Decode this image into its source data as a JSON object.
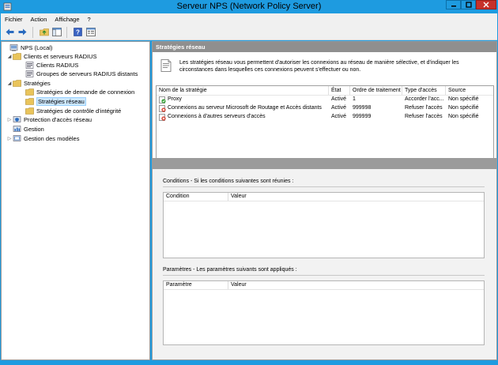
{
  "window": {
    "title": "Serveur NPS (Network Policy Server)"
  },
  "menubar": {
    "items": [
      "Fichier",
      "Action",
      "Affichage",
      "?"
    ]
  },
  "toolbar": {
    "buttons": [
      "back-arrow-icon",
      "forward-arrow-icon",
      "up-folder-icon",
      "show-hide-tree-icon",
      "help-icon",
      "properties-icon"
    ]
  },
  "tree": {
    "root": "NPS (Local)",
    "radius_clients_servers": "Clients et serveurs RADIUS",
    "radius_clients": "Clients RADIUS",
    "remote_radius_groups": "Groupes de serveurs RADIUS distants",
    "policies": "Stratégies",
    "connection_request_policies": "Stratégies de demande de connexion",
    "network_policies": "Stratégies réseau",
    "health_policies": "Stratégies de contrôle d'intégrité",
    "nap": "Protection d'accès réseau",
    "accounting": "Gestion",
    "templates": "Gestion des modèles"
  },
  "main": {
    "header": "Stratégies réseau",
    "info_line1": "Les stratégies réseau vous permettent d'autoriser les connexions au réseau de manière sélective, et d'indiquer les",
    "info_line2": "circonstances dans lesquelles ces connexions peuvent s'effectuer ou non.",
    "columns": [
      "Nom de la stratégie",
      "État",
      "Ordre de traitement",
      "Type d'accès",
      "Source"
    ],
    "policies": [
      {
        "name": "Proxy",
        "state": "Activé",
        "order": "1",
        "access": "Accorder l'acc...",
        "source": "Non spécifié",
        "icon": "policy-allow-icon"
      },
      {
        "name": "Connexions au serveur Microsoft de Routage et Accès distants",
        "state": "Activé",
        "order": "999998",
        "access": "Refuser l'accès",
        "source": "Non spécifié",
        "icon": "policy-deny-icon"
      },
      {
        "name": "Connexions à d'autres serveurs d'accès",
        "state": "Activé",
        "order": "999999",
        "access": "Refuser l'accès",
        "source": "Non spécifié",
        "icon": "policy-deny-icon"
      }
    ],
    "conditions": {
      "title": "Conditions - Si les conditions suivantes sont réunies :",
      "columns": [
        "Condition",
        "Valeur"
      ]
    },
    "settings": {
      "title": "Paramètres - Les paramètres suivants sont appliqués :",
      "columns": [
        "Paramètre",
        "Valeur"
      ]
    }
  },
  "colors": {
    "titlebar": "#1e9be0",
    "close_button": "#c7312a",
    "pane_header": "#8f8f8f"
  }
}
